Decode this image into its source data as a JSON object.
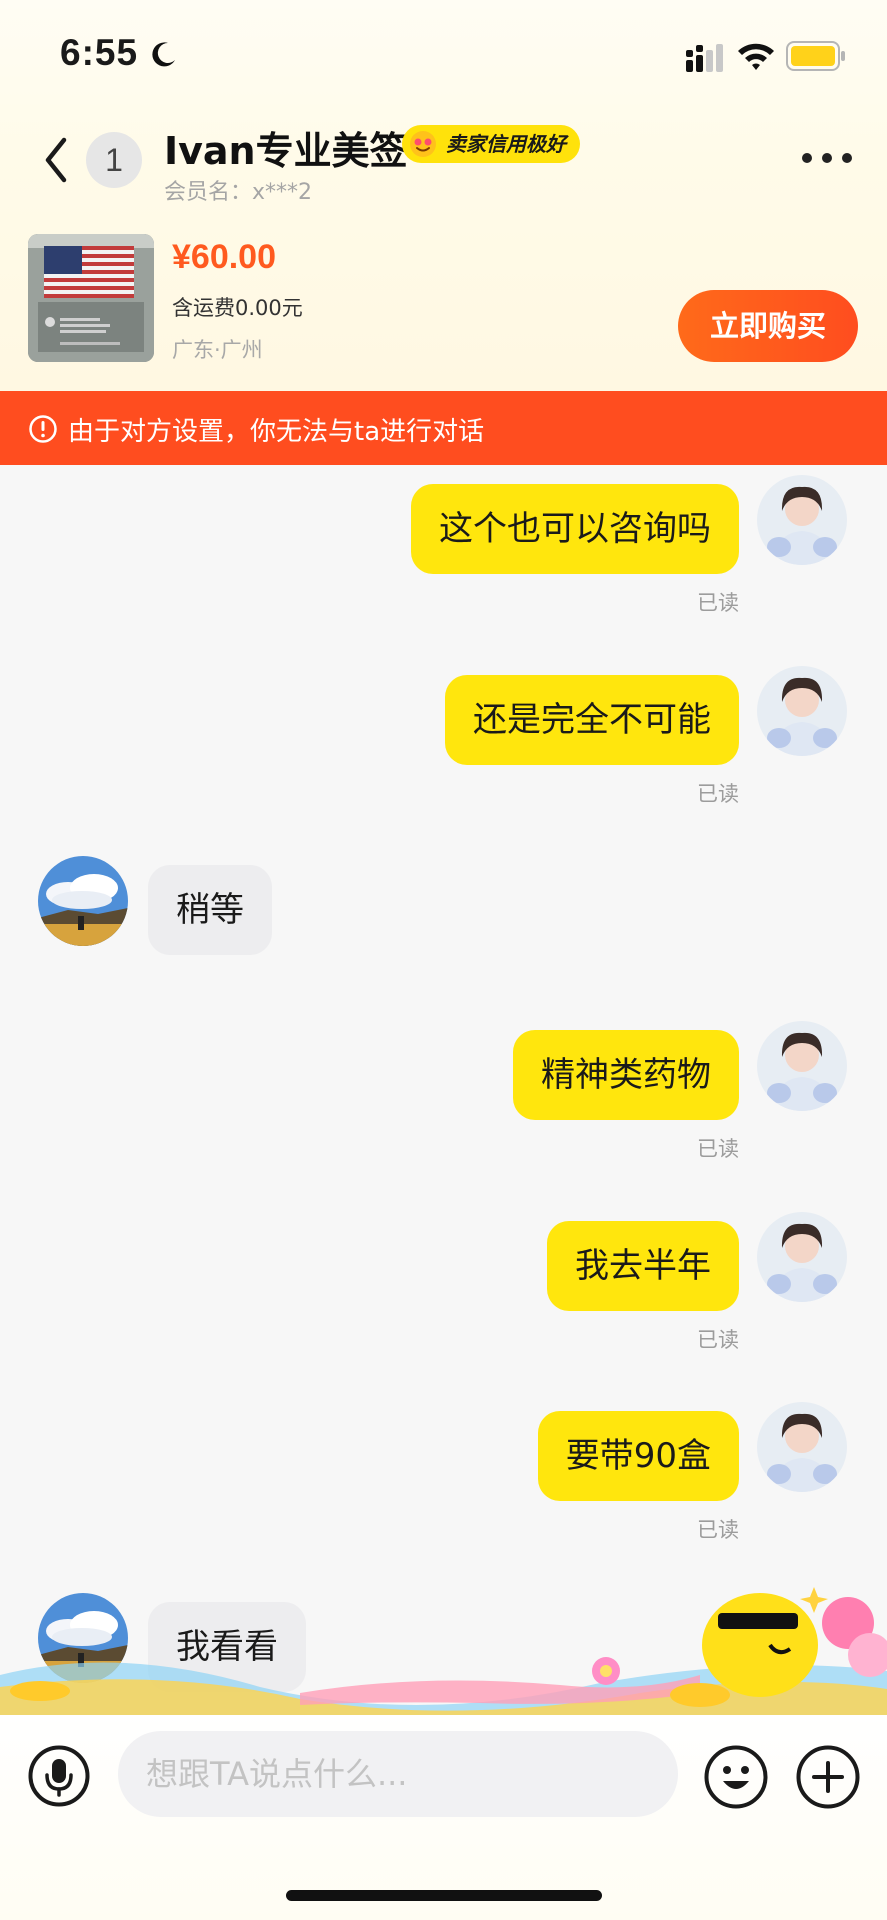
{
  "status_bar": {
    "time": "6:55",
    "icons": [
      "moon-icon",
      "signal-icon",
      "wifi-icon",
      "battery-icon"
    ],
    "battery_color": "#ffd21a"
  },
  "header": {
    "unread_count": "1",
    "title": "Ivan专业美签",
    "credit_badge": "卖家信用极好",
    "member_label": "会员名：",
    "member_name": "x***2",
    "back_icon": "chevron-left-icon",
    "more_icon": "more-dots-icon"
  },
  "product": {
    "price": "¥60.00",
    "shipping": "含运费0.00元",
    "location": "广东·广州",
    "buy_label": "立即购买"
  },
  "warning": {
    "text": "由于对方设置，你无法与ta进行对话",
    "icon": "alert-circle-icon",
    "color": "#ff4d1f"
  },
  "messages": [
    {
      "from": "me",
      "text": "这个也可以咨询吗",
      "status": "已读"
    },
    {
      "from": "me",
      "text": "还是完全不可能",
      "status": "已读"
    },
    {
      "from": "other",
      "text": "稍等"
    },
    {
      "from": "me",
      "text": "精神类药物",
      "status": "已读"
    },
    {
      "from": "me",
      "text": "我去半年",
      "status": "已读"
    },
    {
      "from": "me",
      "text": "要带90盒",
      "status": "已读"
    },
    {
      "from": "other",
      "text": "我看看"
    }
  ],
  "input_bar": {
    "placeholder": "想跟TA说点什么...",
    "icons": [
      "microphone-icon",
      "emoji-icon",
      "plus-icon"
    ]
  },
  "colors": {
    "accent_yellow": "#ffe60d",
    "accent_orange": "#ff5a1f"
  }
}
